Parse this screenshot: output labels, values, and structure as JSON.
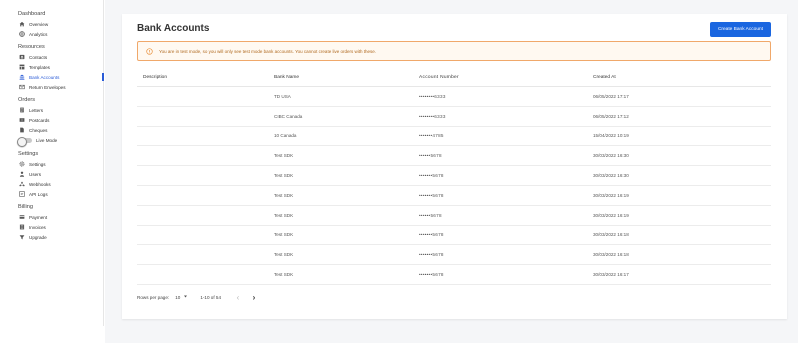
{
  "sidebar": {
    "dashboard": {
      "title": "Dashboard",
      "items": [
        {
          "label": "Overview",
          "icon": "home-icon"
        },
        {
          "label": "Analytics",
          "icon": "globe-icon"
        }
      ]
    },
    "resources": {
      "title": "Resources",
      "items": [
        {
          "label": "Contacts",
          "icon": "contacts-icon"
        },
        {
          "label": "Templates",
          "icon": "templates-icon"
        },
        {
          "label": "Bank Accounts",
          "icon": "bank-icon",
          "active": true
        },
        {
          "label": "Return Envelopes",
          "icon": "envelope-icon"
        }
      ]
    },
    "orders": {
      "title": "Orders",
      "items": [
        {
          "label": "Letters",
          "icon": "letters-icon"
        },
        {
          "label": "Postcards",
          "icon": "postcards-icon"
        },
        {
          "label": "Cheques",
          "icon": "cheques-icon"
        }
      ]
    },
    "live_mode_label": "Live Mode",
    "settings": {
      "title": "Settings",
      "items": [
        {
          "label": "Settings",
          "icon": "gear-icon"
        },
        {
          "label": "Users",
          "icon": "user-icon"
        },
        {
          "label": "Webhooks",
          "icon": "webhook-icon"
        },
        {
          "label": "API Logs",
          "icon": "api-logs-icon"
        }
      ]
    },
    "billing": {
      "title": "Billing",
      "items": [
        {
          "label": "Payment",
          "icon": "payment-icon"
        },
        {
          "label": "Invoices",
          "icon": "invoices-icon"
        },
        {
          "label": "Upgrade",
          "icon": "upgrade-icon"
        }
      ]
    }
  },
  "page": {
    "title": "Bank Accounts",
    "create_button": "Create Bank Account",
    "banner": "You are in test mode, so you will only see test mode bank accounts. You cannot create live orders with these."
  },
  "table": {
    "headers": [
      "Description",
      "Bank Name",
      "Account Number",
      "Created At"
    ],
    "rows": [
      {
        "description": "",
        "bank": "TD USA",
        "account": "••••••••6333",
        "created": "06/05/2022 17:17"
      },
      {
        "description": "",
        "bank": "CIBC Canada",
        "account": "••••••••6333",
        "created": "06/05/2022 17:12"
      },
      {
        "description": "",
        "bank": "10 Canada",
        "account": "•••••••4785",
        "created": "15/04/2022 10:19"
      },
      {
        "description": "",
        "bank": "Test SDK",
        "account": "••••••5678",
        "created": "30/03/2022 16:30"
      },
      {
        "description": "",
        "bank": "Test SDK",
        "account": "•••••••5678",
        "created": "30/03/2022 16:30"
      },
      {
        "description": "",
        "bank": "Test SDK",
        "account": "•••••••5678",
        "created": "30/03/2022 16:19"
      },
      {
        "description": "",
        "bank": "Test SDK",
        "account": "••••••5678",
        "created": "30/03/2022 16:19"
      },
      {
        "description": "",
        "bank": "Test SDK",
        "account": "•••••••5678",
        "created": "30/03/2022 16:18"
      },
      {
        "description": "",
        "bank": "Test SDK",
        "account": "•••••••5678",
        "created": "30/03/2022 16:18"
      },
      {
        "description": "",
        "bank": "Test SDK",
        "account": "•••••••5678",
        "created": "30/03/2022 16:17"
      }
    ]
  },
  "pagination": {
    "rows_per_page_label": "Rows per page:",
    "rows_per_page_value": "10",
    "range": "1-10 of 54",
    "prev": "‹",
    "next": "›"
  },
  "colors": {
    "accent": "#1a66e0",
    "active_nav": "#2a5bd7",
    "banner_border": "#f0a86a",
    "banner_text": "#b06a20"
  }
}
